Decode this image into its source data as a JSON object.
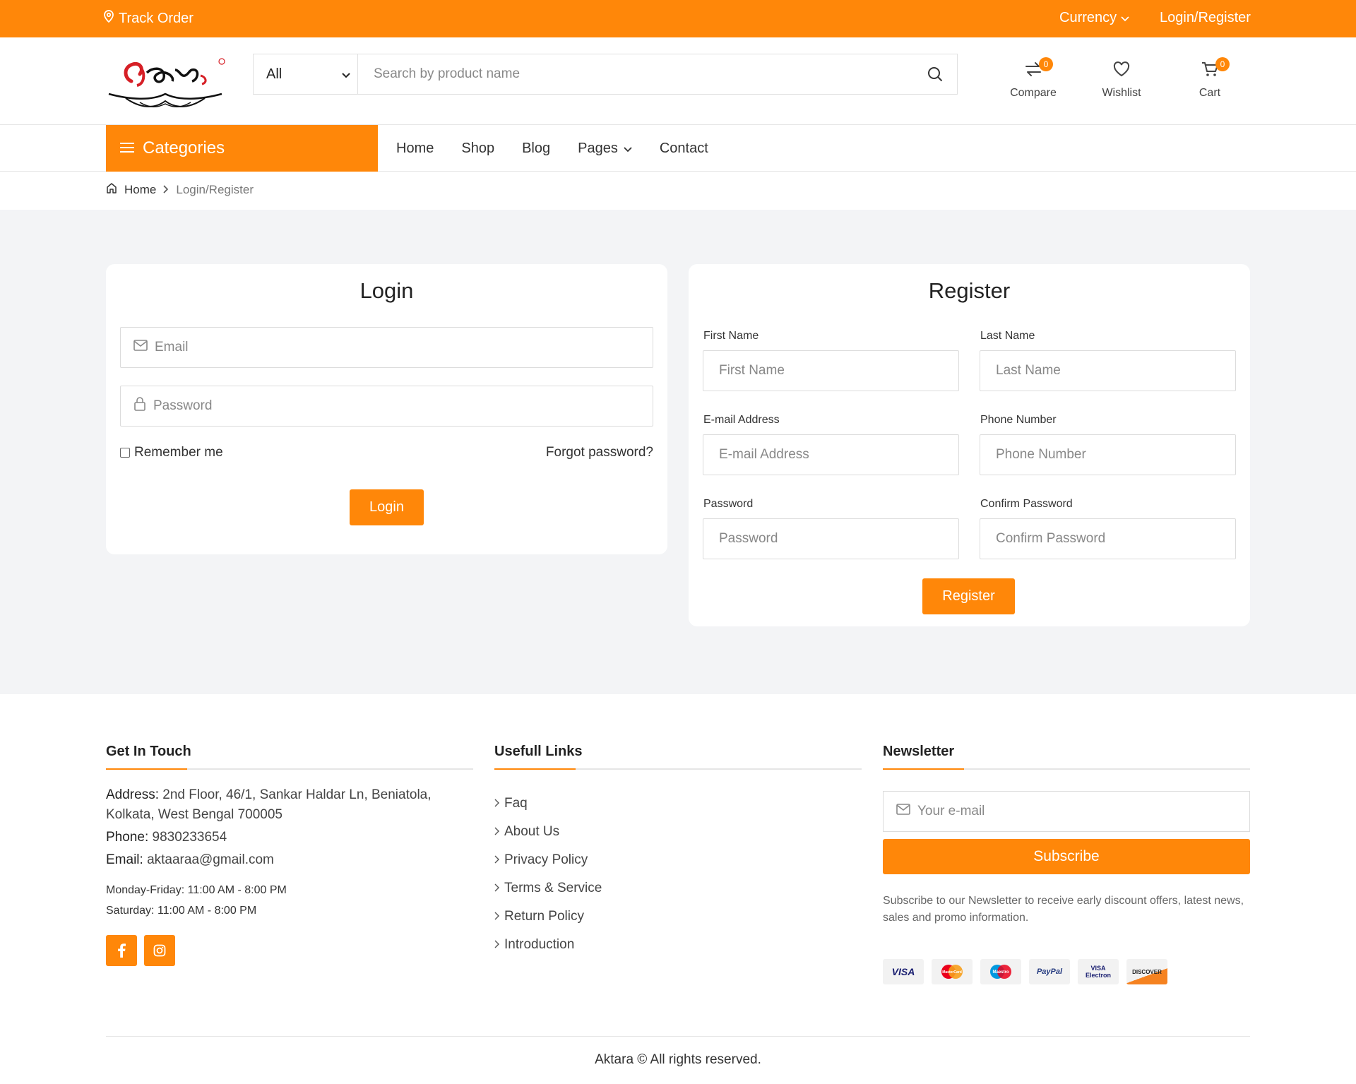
{
  "topbar": {
    "track_order": "Track Order",
    "currency": "Currency",
    "login_register": "Login/Register"
  },
  "header": {
    "search_category": "All",
    "search_placeholder": "Search by product name",
    "compare": {
      "label": "Compare",
      "count": "0"
    },
    "wishlist": {
      "label": "Wishlist"
    },
    "cart": {
      "label": "Cart",
      "count": "0"
    }
  },
  "nav": {
    "categories": "Categories",
    "items": [
      "Home",
      "Shop",
      "Blog",
      "Pages",
      "Contact"
    ]
  },
  "breadcrumb": {
    "home": "Home",
    "current": "Login/Register"
  },
  "login": {
    "title": "Login",
    "email_placeholder": "Email",
    "password_placeholder": "Password",
    "remember": "Remember me",
    "forgot": "Forgot password?",
    "button": "Login"
  },
  "register": {
    "title": "Register",
    "first_name_label": "First Name",
    "first_name_placeholder": "First Name",
    "last_name_label": "Last Name",
    "last_name_placeholder": "Last Name",
    "email_label": "E-mail Address",
    "email_placeholder": "E-mail Address",
    "phone_label": "Phone Number",
    "phone_placeholder": "Phone Number",
    "password_label": "Password",
    "password_placeholder": "Password",
    "confirm_label": "Confirm Password",
    "confirm_placeholder": "Confirm Password",
    "button": "Register"
  },
  "footer": {
    "touch": {
      "title": "Get In Touch",
      "address_label": "Address:",
      "address": "2nd Floor, 46/1, Sankar Haldar Ln, Beniatola, Kolkata, West Bengal 700005",
      "phone_label": "Phone:",
      "phone": "9830233654",
      "email_label": "Email:",
      "email": "aktaaraa@gmail.com",
      "weekdays_label": "Monday-Friday:",
      "weekdays": "11:00 AM - 8:00 PM",
      "saturday_label": "Saturday:",
      "saturday": "11:00 AM - 8:00 PM"
    },
    "links": {
      "title": "Usefull Links",
      "items": [
        "Faq",
        "About Us",
        "Privacy Policy",
        "Terms & Service",
        "Return Policy",
        "Introduction"
      ]
    },
    "newsletter": {
      "title": "Newsletter",
      "placeholder": "Your e-mail",
      "button": "Subscribe",
      "text": "Subscribe to our Newsletter to receive early discount offers, latest news, sales and promo information.",
      "payments": [
        "VISA",
        "MasterCard",
        "Maestro",
        "PayPal",
        "VISA Electron",
        "DISCOVER"
      ]
    },
    "copyright": "Aktara © All rights reserved."
  },
  "colors": {
    "accent": "#ff8709",
    "background": "#f3f4f6"
  }
}
